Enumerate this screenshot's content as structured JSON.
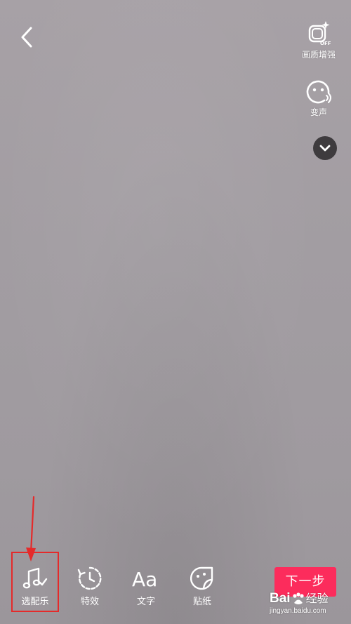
{
  "top_left": {
    "back_icon": "chevron-left-icon"
  },
  "right_tools": [
    {
      "label": "画质增强",
      "icon": "quality-enhance-icon",
      "badge": "OFF"
    },
    {
      "label": "变声",
      "icon": "voice-change-icon"
    },
    {
      "label": "",
      "icon": "chevron-down-icon"
    }
  ],
  "bottom_toolbar": {
    "items": [
      {
        "label": "选配乐",
        "icon": "music-note-check-icon"
      },
      {
        "label": "特效",
        "icon": "effects-timer-icon"
      },
      {
        "label": "文字",
        "icon": "text-aa-icon",
        "glyph": "Aa"
      },
      {
        "label": "贴纸",
        "icon": "sticker-icon"
      }
    ],
    "next_label": "下一步"
  },
  "annotation": {
    "highlight_color": "#e52a2a",
    "target": "选配乐"
  },
  "watermark": {
    "brand": "Bai",
    "brand_cn": "经验",
    "sub": "jingyan.baidu.com"
  },
  "colors": {
    "accent": "#fc2c5c",
    "background": "#a29da2",
    "icon": "#ffffff"
  }
}
